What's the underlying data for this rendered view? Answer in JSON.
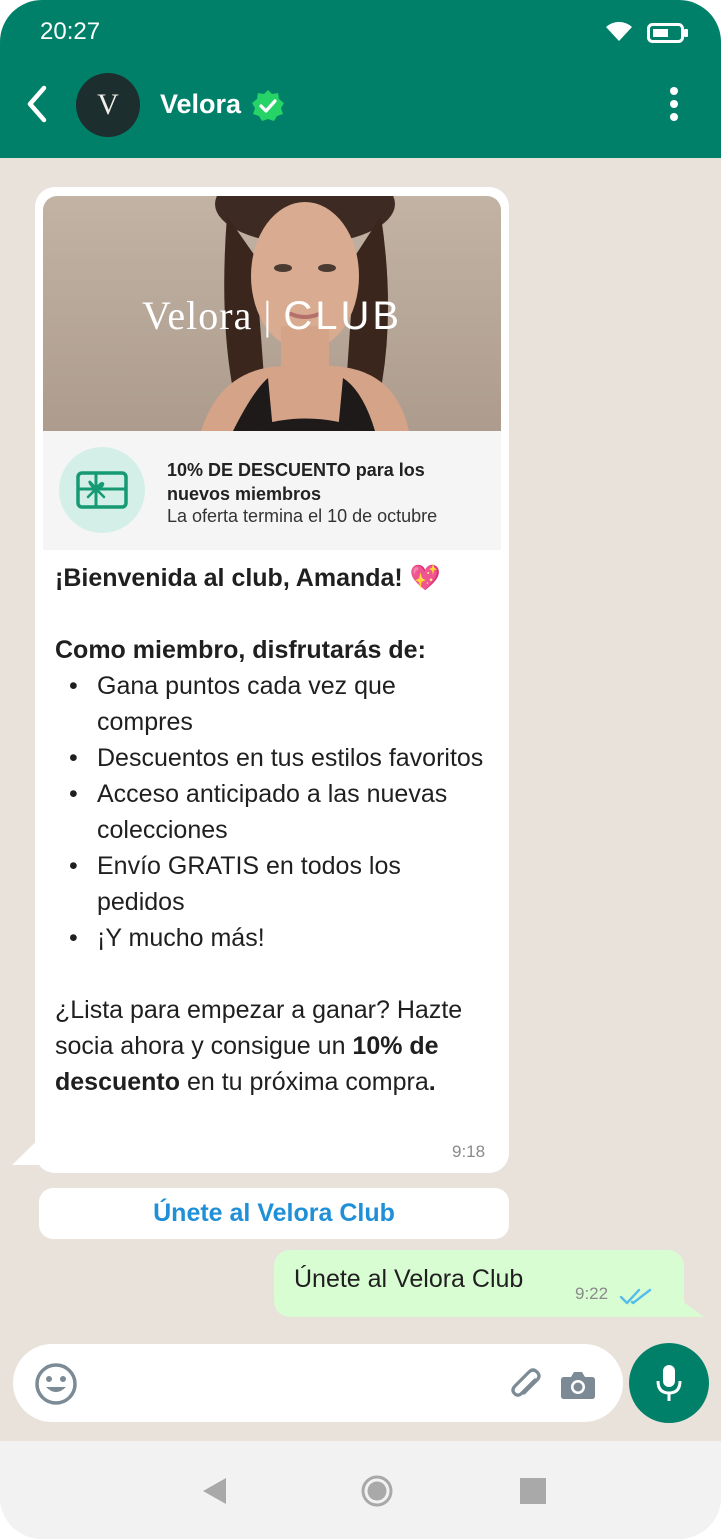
{
  "status_bar": {
    "time": "20:27"
  },
  "header": {
    "contact_name": "Velora",
    "avatar_letter": "V"
  },
  "card": {
    "hero_logo_brand": "Velora",
    "hero_logo_sep": "|",
    "hero_logo_club": "CLUB",
    "offer_title": "10% DE DESCUENTO para los nuevos miembros",
    "offer_subtitle": "La oferta termina el 10 de octubre",
    "greeting": "¡Bienvenida al club, Amanda!",
    "greeting_emoji": "💖",
    "benefits_heading": "Como miembro, disfrutarás de:",
    "benefits": [
      "Gana puntos cada vez que compres",
      "Descuentos en tus estilos favoritos",
      "Acceso anticipado a las nuevas colecciones",
      "Envío GRATIS en todos los pedidos",
      "¡Y mucho más!"
    ],
    "cta_part1": "¿Lista para empezar a ganar? Hazte socia ahora y consigue un ",
    "cta_bold1": "10% de descuento",
    "cta_part2": " en tu próxima compra",
    "cta_end": ".",
    "time": "9:18"
  },
  "quick_reply": {
    "label": "Únete al Velora Club"
  },
  "sent_message": {
    "text": "Únete al Velora Club",
    "time": "9:22"
  },
  "colors": {
    "brand_green": "#008069",
    "chat_bg": "#e9e2da",
    "sent_bubble": "#d9fdd3",
    "link_blue": "#1f8fd8"
  }
}
